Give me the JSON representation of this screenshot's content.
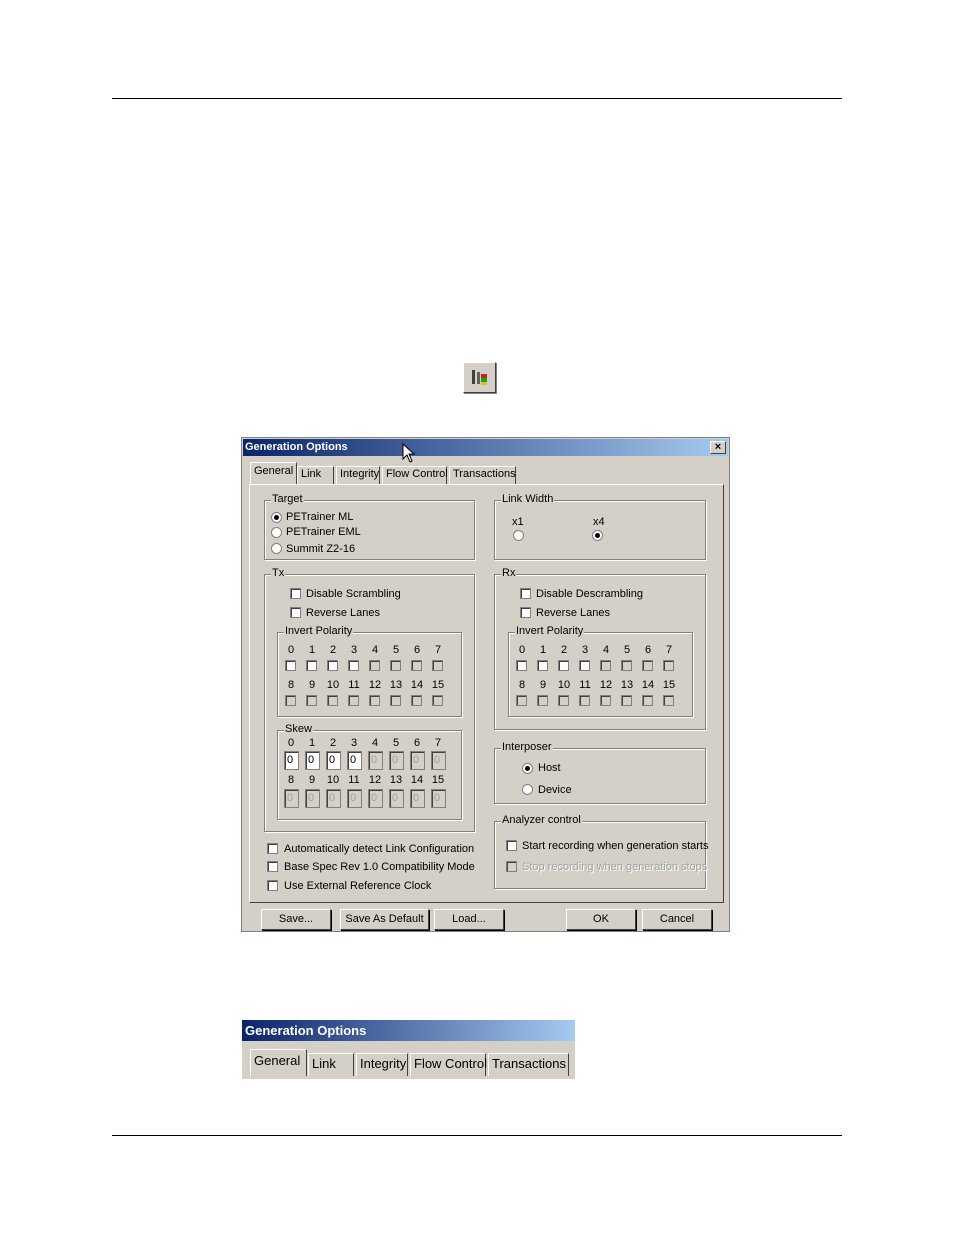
{
  "dialog": {
    "title": "Generation Options",
    "close_glyph": "×",
    "tabs": [
      "General",
      "Link",
      "Integrity",
      "Flow Control",
      "Transactions"
    ],
    "target": {
      "label": "Target",
      "options": [
        "PETrainer ML",
        "PETrainer EML",
        "Summit Z2-16"
      ],
      "selected": "PETrainer ML"
    },
    "link_width": {
      "label": "Link Width",
      "options": [
        "x1",
        "x4"
      ],
      "selected": "x4"
    },
    "tx": {
      "label": "Tx",
      "disable_scrambling": "Disable Scrambling",
      "reverse_lanes": "Reverse Lanes",
      "invert_polarity": "Invert Polarity",
      "skew": "Skew",
      "skew_values": [
        "0",
        "0",
        "0",
        "0",
        "0",
        "0",
        "0",
        "0",
        "0",
        "0",
        "0",
        "0",
        "0",
        "0",
        "0",
        "0"
      ]
    },
    "rx": {
      "label": "Rx",
      "disable_descrambling": "Disable Descrambling",
      "reverse_lanes": "Reverse Lanes",
      "invert_polarity": "Invert Polarity"
    },
    "lanes_top": [
      "0",
      "1",
      "2",
      "3",
      "4",
      "5",
      "6",
      "7"
    ],
    "lanes_bottom": [
      "8",
      "9",
      "10",
      "11",
      "12",
      "13",
      "14",
      "15"
    ],
    "interposer": {
      "label": "Interposer",
      "options": [
        "Host",
        "Device"
      ],
      "selected": "Host"
    },
    "analyzer": {
      "label": "Analyzer control",
      "start_recording": "Start recording when generation starts",
      "stop_recording": "Stop recording when generation stops"
    },
    "options": {
      "auto_detect": "Automatically detect Link Configuration",
      "base_spec": "Base Spec Rev 1.0 Compatibility Mode",
      "external_clock": "Use External Reference Clock"
    },
    "buttons": {
      "save": "Save...",
      "save_default": "Save As Default",
      "load": "Load...",
      "ok": "OK",
      "cancel": "Cancel"
    }
  },
  "strip": {
    "title": "Generation Options",
    "tabs": [
      "General",
      "Link",
      "Integrity",
      "Flow Control",
      "Transactions"
    ]
  }
}
